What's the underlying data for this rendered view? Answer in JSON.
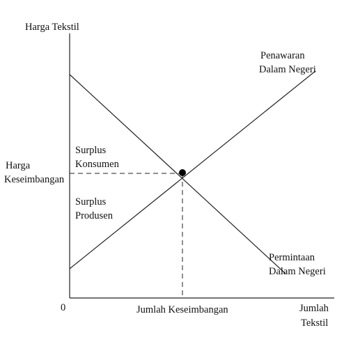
{
  "title": "Harga Tekstil",
  "axes": {
    "y_label": "Harga Tekstil",
    "x_label_line1": "Jumlah",
    "x_label_line2": "Tekstil",
    "origin_label": "0"
  },
  "curves": {
    "supply_line1": "Penawaran",
    "supply_line2": "Dalam Negeri",
    "demand_line1": "Permintaan",
    "demand_line2": "Dalam Negeri"
  },
  "equilibrium": {
    "price_line1": "Harga",
    "price_line2": "Keseimbangan",
    "quantity": "Jumlah Keseimbangan"
  },
  "regions": {
    "consumer_line1": "Surplus",
    "consumer_line2": "Konsumen",
    "producer_line1": "Surplus",
    "producer_line2": "Produsen"
  },
  "colors": {
    "line": "#222222",
    "point": "#000000"
  }
}
